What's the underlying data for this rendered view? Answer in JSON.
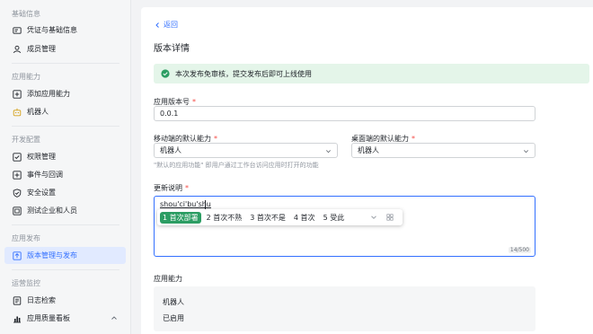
{
  "sidebar": {
    "sections": {
      "basic": "基础信息",
      "ability": "应用能力",
      "dev": "开发配置",
      "release": "应用发布",
      "ops": "运营监控"
    },
    "items": {
      "credentials": "凭证与基础信息",
      "members": "成员管理",
      "add_ability": "添加应用能力",
      "bot": "机器人",
      "permissions": "权限管理",
      "events": "事件与回调",
      "security": "安全设置",
      "test_org": "测试企业和人员",
      "version": "版本管理与发布",
      "logs": "日志检索",
      "quality": "应用质量看板"
    },
    "active": "version"
  },
  "main": {
    "back_label": "返回",
    "title": "版本详情",
    "alert": "本次发布免审核，提交发布后即可上线使用",
    "version_label": "应用版本号",
    "version_value": "0.0.1",
    "mobile_label": "移动端的默认能力",
    "mobile_value": "机器人",
    "desktop_label": "桌面端的默认能力",
    "desktop_value": "机器人",
    "default_hint": "\"默认的应用功能\" 即用户通过工作台访问应用时打开的功能",
    "notes_label": "更新说明",
    "notes_typing": "shou'ci'bu'shu",
    "notes_counter": "14/500",
    "ability_title": "应用能力",
    "ability_name": "机器人",
    "ability_status": "已启用"
  },
  "ime": {
    "candidates": [
      "1 首次部署",
      "2 首次不熟",
      "3 首次不是",
      "4 首次",
      "5 受此"
    ]
  },
  "colors": {
    "accent": "#3370ff",
    "success": "#2c9d63",
    "required": "#f54a45"
  }
}
